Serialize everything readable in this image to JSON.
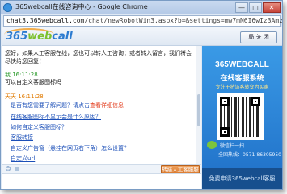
{
  "window": {
    "title": "365webcall在线咨询中心 - Google Chrome",
    "url_prefix": "chat3.365webcall.com",
    "url_rest": "/chat/newRobotWin3.aspx?b=&settings=mw7mN6I6wIz3Amz3Amm6mmXm",
    "minimize": "—",
    "maximize": "□",
    "close": "✕"
  },
  "header": {
    "logo_num": "365",
    "logo_web": "web",
    "logo_call": "call",
    "close_chat_label": "局 关 闭"
  },
  "chat": {
    "greeting": "您好，如果人工客服在线，您也可以转人工咨询；或者转入留言，我们将会尽快给您回复！",
    "msg1_sender": "我 16:11:28",
    "msg1_text": "可以自定义客服图标吗",
    "msg2_sender": "天天 16:11:28",
    "msg2_q1": "是否有您需要了解问题？请点击",
    "msg2_q1_hl": "查看详细信息",
    "msg2_q1_end": "!",
    "link1": "在线客服图标不显示会是什么原因？",
    "link2": "如何自定义客服图标？",
    "link3": "客服转接",
    "link4": "自定义广告窗（悬挂在网页右下角）怎么设置？",
    "link5": "自定义url"
  },
  "toolbar": {
    "send_label": "转接人工客服服务"
  },
  "ad": {
    "brand": "365WEBCALL",
    "sub1": "在线客服系统",
    "sub2": "专注于将访客转变为买家",
    "wechat_text": "微信扫一扫",
    "phone": "全国热线：0571-86305950",
    "footer": "免费申请365webcall客服"
  }
}
